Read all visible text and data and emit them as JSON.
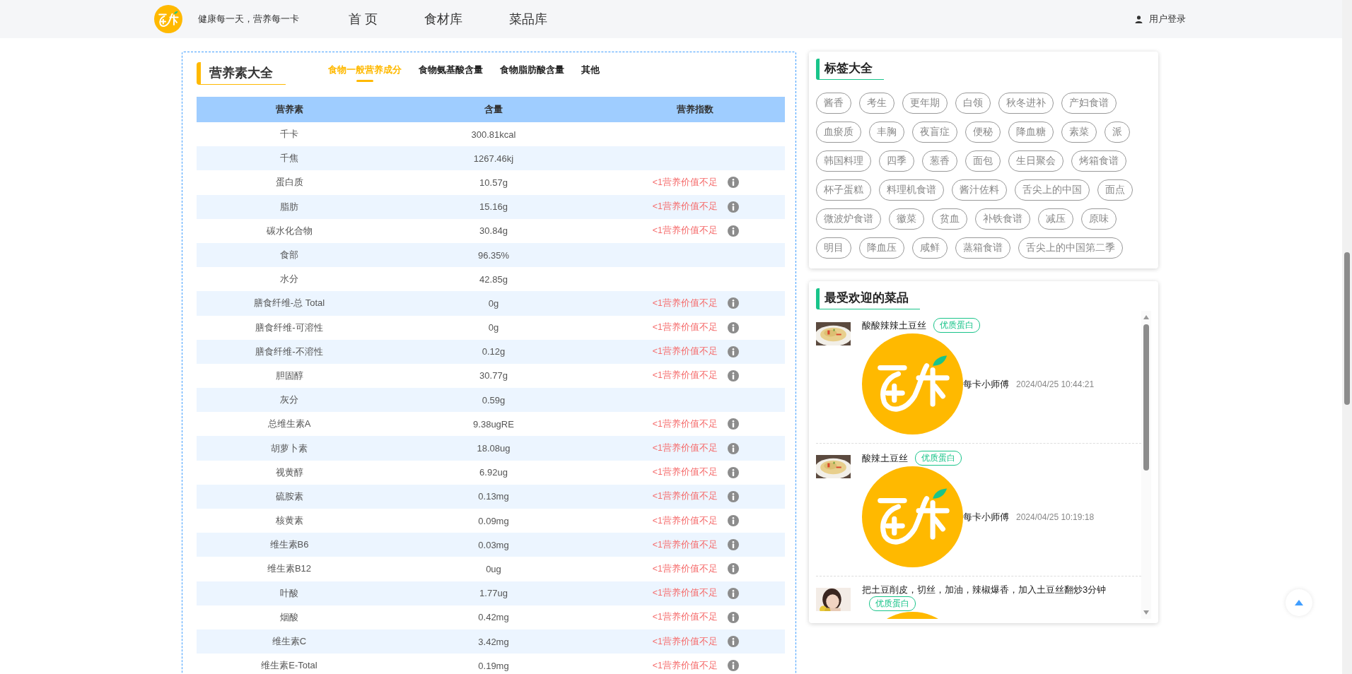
{
  "header": {
    "slogan": "健康每一天，营养每一卡",
    "nav": [
      "首 页",
      "食材库",
      "菜品库"
    ],
    "login": "用户登录"
  },
  "nutrition": {
    "title": "营养素大全",
    "tabs": [
      {
        "label": "食物一般营养成分",
        "selected": true
      },
      {
        "label": "食物氨基酸含量",
        "selected": false
      },
      {
        "label": "食物脂肪酸含量",
        "selected": false
      },
      {
        "label": "其他",
        "selected": false
      }
    ],
    "columns": [
      "营养素",
      "含量",
      "营养指数"
    ],
    "rows": [
      {
        "nutrient": "千卡",
        "amount": "300.81kcal"
      },
      {
        "nutrient": "千焦",
        "amount": "1267.46kj"
      },
      {
        "nutrient": "蛋白质",
        "amount": "10.57g",
        "index": "<1营养价值不足"
      },
      {
        "nutrient": "脂肪",
        "amount": "15.16g",
        "index": "<1营养价值不足"
      },
      {
        "nutrient": "碳水化合物",
        "amount": "30.84g",
        "index": "<1营养价值不足"
      },
      {
        "nutrient": "食部",
        "amount": "96.35%"
      },
      {
        "nutrient": "水分",
        "amount": "42.85g"
      },
      {
        "nutrient": "膳食纤维-总 Total",
        "amount": "0g",
        "index": "<1营养价值不足"
      },
      {
        "nutrient": "膳食纤维-可溶性",
        "amount": "0g",
        "index": "<1营养价值不足"
      },
      {
        "nutrient": "膳食纤维-不溶性",
        "amount": "0.12g",
        "index": "<1营养价值不足"
      },
      {
        "nutrient": "胆固醇",
        "amount": "30.77g",
        "index": "<1营养价值不足"
      },
      {
        "nutrient": "灰分",
        "amount": "0.59g"
      },
      {
        "nutrient": "总维生素A",
        "amount": "9.38ugRE",
        "index": "<1营养价值不足"
      },
      {
        "nutrient": "胡萝卜素",
        "amount": "18.08ug",
        "index": "<1营养价值不足"
      },
      {
        "nutrient": "视黄醇",
        "amount": "6.92ug",
        "index": "<1营养价值不足"
      },
      {
        "nutrient": "硫胺素",
        "amount": "0.13mg",
        "index": "<1营养价值不足"
      },
      {
        "nutrient": "核黄素",
        "amount": "0.09mg",
        "index": "<1营养价值不足"
      },
      {
        "nutrient": "维生素B6",
        "amount": "0.03mg",
        "index": "<1营养价值不足"
      },
      {
        "nutrient": "维生素B12",
        "amount": "0ug",
        "index": "<1营养价值不足"
      },
      {
        "nutrient": "叶酸",
        "amount": "1.77ug",
        "index": "<1营养价值不足"
      },
      {
        "nutrient": "烟酸",
        "amount": "0.42mg",
        "index": "<1营养价值不足"
      },
      {
        "nutrient": "维生素C",
        "amount": "3.42mg",
        "index": "<1营养价值不足"
      },
      {
        "nutrient": "维生素E-Total",
        "amount": "0.19mg",
        "index": "<1营养价值不足"
      }
    ]
  },
  "tags": {
    "title": "标签大全",
    "items": [
      "酱香",
      "考生",
      "更年期",
      "白领",
      "秋冬进补",
      "产妇食谱",
      "血瘀质",
      "丰胸",
      "夜盲症",
      "便秘",
      "降血糖",
      "素菜",
      "派",
      "韩国料理",
      "四季",
      "葱香",
      "面包",
      "生日聚会",
      "烤箱食谱",
      "杯子蛋糕",
      "料理机食谱",
      "酱汁佐料",
      "舌尖上的中国",
      "面点",
      "微波炉食谱",
      "徽菜",
      "贫血",
      "补铁食谱",
      "减压",
      "原味",
      "明目",
      "降血压",
      "咸鲜",
      "蒸箱食谱",
      "舌尖上的中国第二季"
    ]
  },
  "popular": {
    "title": "最受欢迎的菜品",
    "dishes": [
      {
        "kind": "food",
        "title": "酸酸辣辣土豆丝",
        "tag": "优质蛋白",
        "author": "每卡小师傅",
        "time": "2024/04/25 10:44:21"
      },
      {
        "kind": "food",
        "title": "酸辣土豆丝",
        "tag": "优质蛋白",
        "author": "每卡小师傅",
        "time": "2024/04/25 10:19:18"
      },
      {
        "kind": "person",
        "title": "把土豆削皮，切丝，加油，辣椒爆香，加入土豆丝翻炒3分钟",
        "tag": "优质蛋白"
      }
    ]
  }
}
